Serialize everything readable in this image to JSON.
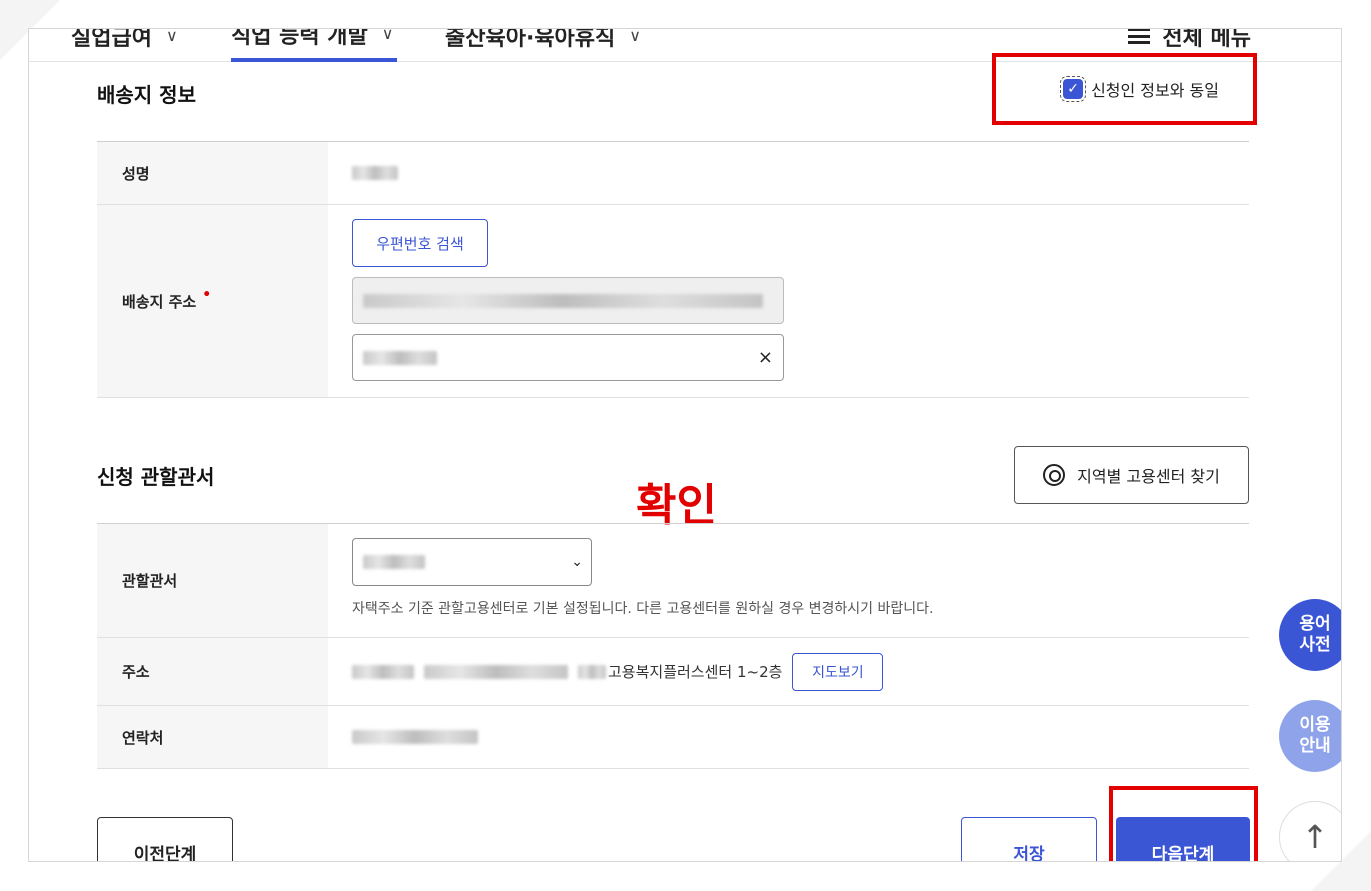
{
  "nav": {
    "tabs": [
      {
        "label": "실업급여",
        "active": false
      },
      {
        "label": "직업 능력 개발",
        "active": true
      },
      {
        "label": "출산육아·육아휴직",
        "active": false
      }
    ],
    "menu_label": "전체 메뉴"
  },
  "shipping": {
    "title": "배송지 정보",
    "same_as_applicant": {
      "label": "신청인 정보와 동일",
      "checked": true
    },
    "name_label": "성명",
    "address_label": "배송지 주소",
    "required_mark": "•",
    "postcode_button": "우편번호 검색",
    "clear_icon": "×"
  },
  "office": {
    "title": "신청 관할관서",
    "find_button": "지역별 고용센터 찾기",
    "office_label": "관할관서",
    "select_caret": "⌄",
    "hint": "자택주소 기준 관할고용센터로 기본 설정됩니다. 다른 고용센터를 원하실 경우 변경하시기 바랍니다.",
    "address_label": "주소",
    "address_suffix": "고용복지플러스센터 1~2층",
    "map_button": "지도보기",
    "contact_label": "연락처"
  },
  "annotation": {
    "confirm_text": "확인"
  },
  "side": {
    "dictionary": [
      "용어",
      "사전"
    ],
    "guide": [
      "이용",
      "안내"
    ],
    "top_arrow": "↑"
  },
  "footer": {
    "prev_label": "이전단계",
    "save_label": "저장",
    "next_label": "다음단계"
  },
  "colors": {
    "accent": "#3b56d4",
    "highlight": "#e30000"
  }
}
